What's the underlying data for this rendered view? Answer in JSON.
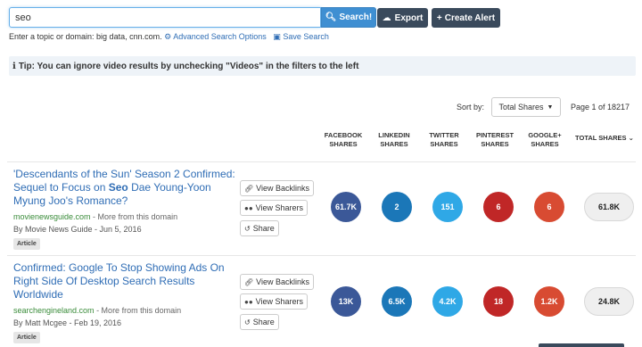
{
  "search": {
    "value": "seo",
    "button_label": "Search!",
    "button_icon": "search-icon"
  },
  "toolbar": {
    "export_label": "Export",
    "export_icon": "cloud-download-icon",
    "alert_label": "Create Alert",
    "alert_icon": "plus-icon"
  },
  "hint": {
    "text": "Enter a topic or domain: big data, cnn.com.",
    "advanced_link": "Advanced Search Options",
    "save_link": "Save Search"
  },
  "tip": {
    "text": "Tip: You can ignore video results by unchecking \"Videos\" in the filters to the left"
  },
  "sort": {
    "label": "Sort by:",
    "selected": "Total Shares"
  },
  "pagination": {
    "text": "Page 1 of 18217"
  },
  "columns": {
    "facebook": [
      "FACEBOOK",
      "SHARES"
    ],
    "linkedin": [
      "LINKEDIN",
      "SHARES"
    ],
    "twitter": [
      "TWITTER",
      "SHARES"
    ],
    "pinterest": [
      "PINTEREST",
      "SHARES"
    ],
    "googleplus": [
      "GOOGLE+",
      "SHARES"
    ],
    "total": "TOTAL SHARES"
  },
  "actions": {
    "backlinks": "View Backlinks",
    "sharers": "View Sharers",
    "share": "Share"
  },
  "results": [
    {
      "title_pre": "'Descendants of the Sun' Season 2 Confirmed: Sequel to Focus on ",
      "title_bold": "Seo",
      "title_post": " Dae Young-Yoon Myung Joo's Romance?",
      "domain": "movienewsguide.com",
      "more": " - More from this domain",
      "author": "By Movie News Guide - Jun 5, 2016",
      "tag": "Article",
      "facebook": "61.7K",
      "linkedin": "2",
      "twitter": "151",
      "pinterest": "6",
      "googleplus": "6",
      "total": "61.8K"
    },
    {
      "title_pre": "Confirmed: Google To Stop Showing Ads On Right Side Of Desktop Search Results Worldwide",
      "title_bold": "",
      "title_post": "",
      "domain": "searchengineland.com",
      "more": " - More from this domain",
      "author": "By Matt Mcgee - Feb 19, 2016",
      "tag": "Article",
      "facebook": "13K",
      "linkedin": "6.5K",
      "twitter": "4.2K",
      "pinterest": "18",
      "googleplus": "1.2K",
      "total": "24.8K"
    }
  ],
  "colors": {
    "primary": "#3f8fd2",
    "dark_button": "#3a4a5c",
    "link": "#2f6db5",
    "domain": "#3a8c3a",
    "facebook": "#3b5898",
    "linkedin": "#1b77b8",
    "twitter": "#2fa8e6",
    "pinterest": "#c02727",
    "googleplus": "#d84b32"
  }
}
